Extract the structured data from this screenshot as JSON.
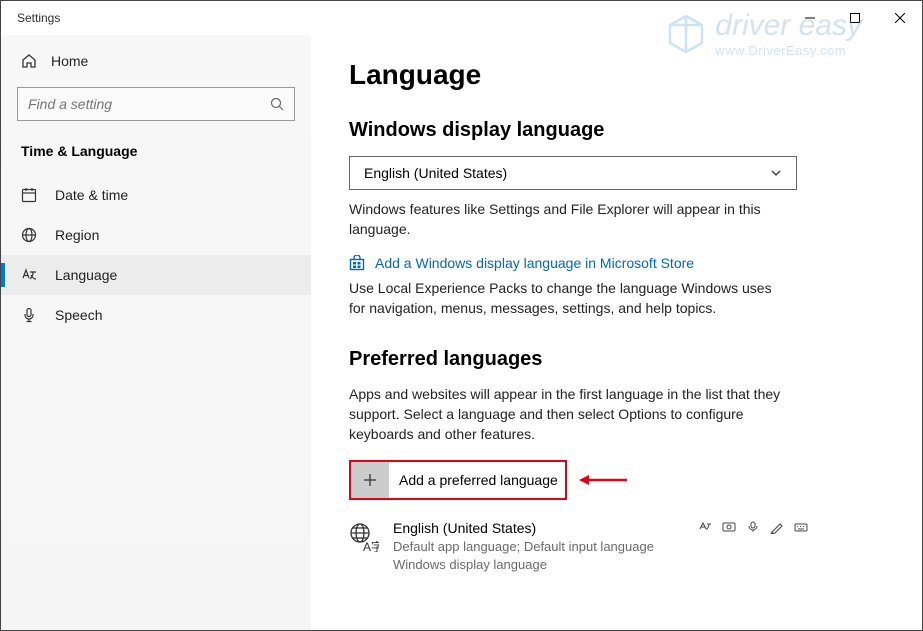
{
  "window": {
    "title": "Settings"
  },
  "sidebar": {
    "home": "Home",
    "search_placeholder": "Find a setting",
    "group": "Time & Language",
    "items": [
      {
        "label": "Date & time"
      },
      {
        "label": "Region"
      },
      {
        "label": "Language"
      },
      {
        "label": "Speech"
      }
    ]
  },
  "page": {
    "title": "Language",
    "display": {
      "heading": "Windows display language",
      "selected": "English (United States)",
      "desc": "Windows features like Settings and File Explorer will appear in this language.",
      "store_link": "Add a Windows display language in Microsoft Store",
      "packs_desc": "Use Local Experience Packs to change the language Windows uses for navigation, menus, messages, settings, and help topics."
    },
    "preferred": {
      "heading": "Preferred languages",
      "desc": "Apps and websites will appear in the first language in the list that they support. Select a language and then select Options to configure keyboards and other features.",
      "add_label": "Add a preferred language",
      "lang": {
        "name": "English (United States)",
        "sub1": "Default app language; Default input language",
        "sub2": "Windows display language"
      }
    }
  },
  "watermark": {
    "main": "driver easy",
    "sub": "www.DriverEasy.com"
  }
}
